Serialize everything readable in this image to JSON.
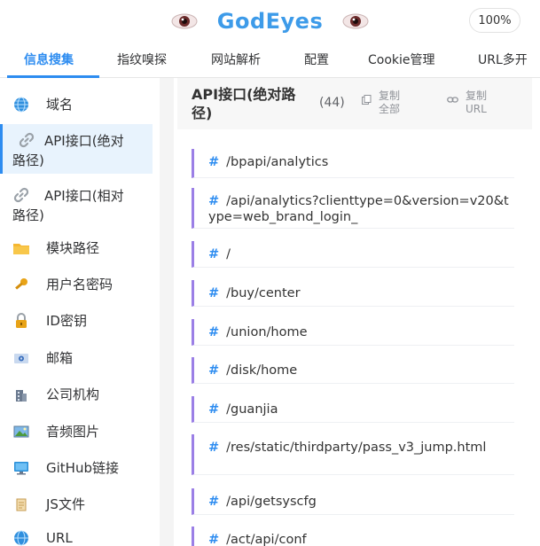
{
  "app": {
    "name": "GodEyes",
    "zoom": "100%"
  },
  "tabs": [
    {
      "label": "信息搜集",
      "active": true
    },
    {
      "label": "指纹嗅探"
    },
    {
      "label": "网站解析"
    },
    {
      "label": "配置"
    },
    {
      "label": "Cookie管理"
    },
    {
      "label": "URL多开"
    }
  ],
  "sidebar": {
    "items": [
      {
        "label": "域名",
        "icon": "globe-icon"
      },
      {
        "label": "API接口(绝对路径)",
        "icon": "link-icon",
        "active": true
      },
      {
        "label": "API接口(相对路径)",
        "icon": "link-icon"
      },
      {
        "label": "模块路径",
        "icon": "folder-icon"
      },
      {
        "label": "用户名密码",
        "icon": "key-icon"
      },
      {
        "label": "ID密钥",
        "icon": "lock-icon"
      },
      {
        "label": "邮箱",
        "icon": "mail-icon"
      },
      {
        "label": "公司机构",
        "icon": "building-icon"
      },
      {
        "label": "音频图片",
        "icon": "image-icon"
      },
      {
        "label": "GitHub链接",
        "icon": "monitor-icon"
      },
      {
        "label": "JS文件",
        "icon": "scroll-icon"
      },
      {
        "label": "URL",
        "icon": "globe-icon"
      }
    ]
  },
  "main": {
    "title": "API接口(绝对路径)",
    "count": "(44)",
    "copy_all": "复制全部",
    "copy_url": "复制URL",
    "results": [
      "/bpapi/analytics",
      "/api/analytics?clienttype=0&version=v20&type=web_brand_login_",
      "/",
      "/buy/center",
      "/union/home",
      "/disk/home",
      "/guanjia",
      "/res/static/thirdparty/pass_v3_jump.html",
      "/api/getsyscfg",
      "/act/api/conf"
    ]
  },
  "colors": {
    "accent": "#2d8cf0",
    "row_border": "#9b7fe6",
    "brand": "#3d9be9"
  }
}
